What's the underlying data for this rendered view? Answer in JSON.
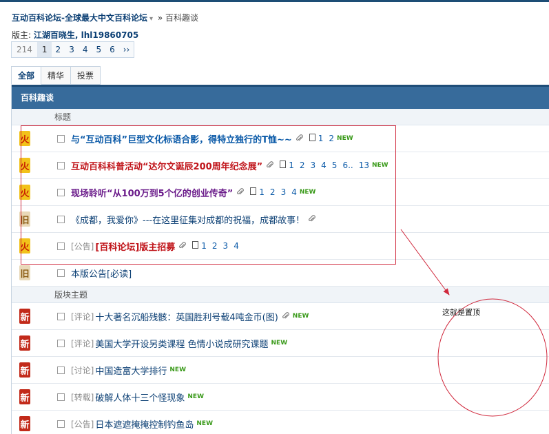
{
  "header": {
    "site_title": "互动百科论坛-全球最大中文百科论坛",
    "breadcrumb_sep": "»",
    "breadcrumb_current": "百科趣谈",
    "moderators_label": "版主:",
    "moderators": "江湖百晓生, lhl19860705"
  },
  "pager": {
    "total": "214",
    "pages": [
      "1",
      "2",
      "3",
      "4",
      "5",
      "6"
    ],
    "current": "1",
    "next": "››"
  },
  "tabs": [
    "全部",
    "精华",
    "投票"
  ],
  "forum_name": "百科趣谈",
  "sections": {
    "pinned_label": "标题",
    "forum_topics_label": "版块主题"
  },
  "badges": {
    "hot": "火",
    "old": "旧",
    "new": "新"
  },
  "pinned": [
    {
      "badge": "hot",
      "prefix": "",
      "title": "与“互动百科”巨型文化标语合影，得特立独行的T恤~~",
      "style": "t-blue",
      "clip": true,
      "pages": [
        "1",
        "2"
      ],
      "new": "NEW"
    },
    {
      "badge": "hot",
      "prefix": "",
      "title": "互动百科科普活动“达尔文诞辰200周年纪念展”",
      "style": "t-red",
      "clip": true,
      "pages": [
        "1",
        "2",
        "3",
        "4",
        "5",
        "6..",
        "13"
      ],
      "new": "NEW"
    },
    {
      "badge": "hot",
      "prefix": "",
      "title": "现场聆听“从100万到5个亿的创业传奇”",
      "style": "t-purple",
      "clip": true,
      "pages": [
        "1",
        "2",
        "3",
        "4"
      ],
      "new": "NEW"
    },
    {
      "badge": "old",
      "prefix": "",
      "title": "《成都，我爱你》---在这里征集对成都的祝福，成都故事！",
      "style": "t-plain",
      "clip": true,
      "pages": [],
      "new": ""
    },
    {
      "badge": "hot",
      "prefix": "[公告]",
      "title": "[百科论坛]版主招募",
      "style": "t-red",
      "clip": true,
      "pages": [
        "1",
        "2",
        "3",
        "4"
      ],
      "new": ""
    },
    {
      "badge": "old",
      "prefix": "",
      "title": "本版公告[必读]",
      "style": "t-plain",
      "clip": false,
      "pages": [],
      "new": ""
    }
  ],
  "topics": [
    {
      "badge": "new",
      "prefix": "[评论]",
      "title": "十大著名沉船残骸：英国胜利号载4吨金币(图)",
      "style": "t-plain",
      "clip": true,
      "pages": [],
      "new": "NEW"
    },
    {
      "badge": "new",
      "prefix": "[评论]",
      "title": "美国大学开设另类课程 色情小说成研究课题",
      "style": "t-plain",
      "clip": false,
      "pages": [],
      "new": "NEW"
    },
    {
      "badge": "new",
      "prefix": "[讨论]",
      "title": "中国造富大学排行",
      "style": "t-plain",
      "clip": false,
      "pages": [],
      "new": "NEW"
    },
    {
      "badge": "new",
      "prefix": "[转载]",
      "title": "破解人体十三个怪现象",
      "style": "t-plain",
      "clip": false,
      "pages": [],
      "new": "NEW"
    },
    {
      "badge": "new",
      "prefix": "[公告]",
      "title": "日本遮遮掩掩控制钓鱼岛",
      "style": "t-plain",
      "clip": false,
      "pages": [],
      "new": "NEW"
    }
  ],
  "annotation": {
    "text": "这就是置顶",
    "color": "#d0283c"
  }
}
